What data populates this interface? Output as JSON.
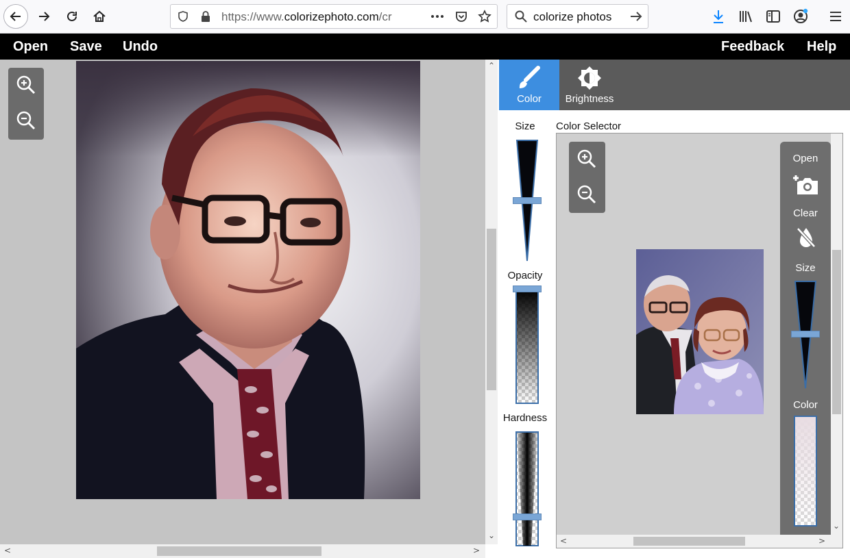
{
  "browser": {
    "url_prefix": "https://www.",
    "url_host": "colorizephoto.com",
    "url_suffix": "/cr",
    "search_query": "colorize photos",
    "icons": {
      "back": "back-arrow-icon",
      "forward": "forward-arrow-icon",
      "reload": "reload-icon",
      "home": "home-icon",
      "shield": "tracking-shield-icon",
      "lock": "lock-icon",
      "more": "more-icon",
      "pocket": "pocket-icon",
      "bookmark": "star-icon",
      "search": "search-icon",
      "go": "go-arrow-icon",
      "download": "download-icon",
      "library": "library-icon",
      "sidebar": "sidebar-icon",
      "account": "account-icon",
      "menu": "hamburger-menu-icon"
    }
  },
  "menubar": {
    "open": "Open",
    "save": "Save",
    "undo": "Undo",
    "feedback": "Feedback",
    "help": "Help"
  },
  "tools": {
    "tab_color": "Color",
    "tab_brightness": "Brightness",
    "size_label": "Size",
    "opacity_label": "Opacity",
    "hardness_label": "Hardness",
    "size_value": 0.5,
    "opacity_value": 0.0,
    "hardness_value": 0.75
  },
  "color_selector": {
    "title": "Color Selector",
    "open_label": "Open",
    "clear_label": "Clear",
    "size_label": "Size",
    "color_label": "Color",
    "size_value": 0.5
  },
  "colors": {
    "active_tab": "#3d8ee0",
    "menubar": "#000000",
    "panel_dark": "#6b6b6b",
    "slider_handle": "#7aa6d6"
  }
}
